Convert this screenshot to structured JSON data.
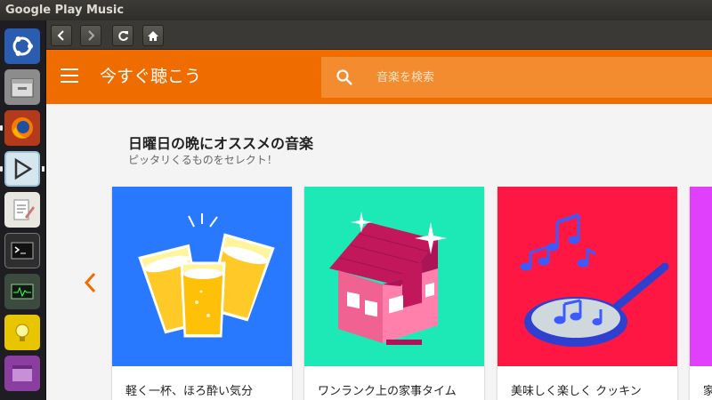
{
  "window": {
    "title": "Google Play Music"
  },
  "launcher": {
    "items": [
      "ubuntu-dash-icon",
      "files-icon",
      "firefox-icon",
      "music-player-icon",
      "text-editor-icon",
      "terminal-icon",
      "system-monitor-icon",
      "notes-icon",
      "workspace-icon"
    ]
  },
  "navbar": {
    "back": "back-icon",
    "forward": "forward-icon",
    "reload": "reload-icon",
    "home": "home-icon"
  },
  "appbar": {
    "title": "今すぐ聴こう",
    "search_placeholder": "音楽を検索",
    "accent": "#ef6c00"
  },
  "section": {
    "title": "日曜日の晩にオススメの音楽",
    "subtitle": "ピッタリくるものをセレクト！"
  },
  "cards": [
    {
      "label": "軽く一杯、ほろ酔い気分",
      "color": "#2979ff"
    },
    {
      "label": "ワンランク上の家事タイム",
      "color": "#1de9b6"
    },
    {
      "label": "美味しく楽しく クッキン",
      "color": "#ff1744"
    },
    {
      "label": "家",
      "color": "#e040fb"
    }
  ]
}
